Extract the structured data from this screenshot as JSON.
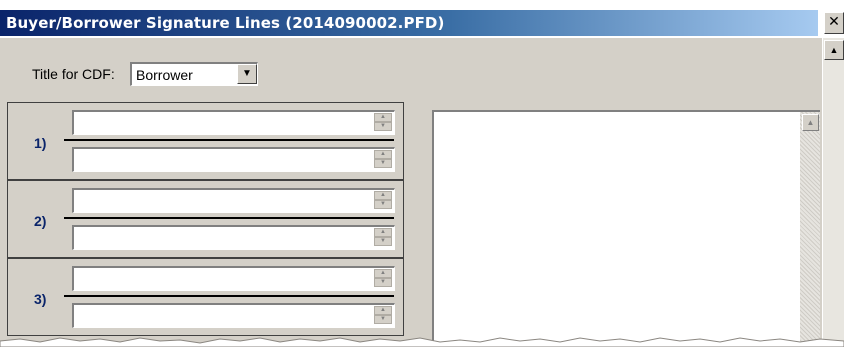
{
  "window": {
    "title": "Buyer/Borrower Signature Lines (2014090002.PFD)",
    "close_glyph": "✕"
  },
  "cdf": {
    "label": "Title for CDF:",
    "selected": "Borrower"
  },
  "signature_groups": [
    {
      "number": "1)",
      "line1": "",
      "line2": ""
    },
    {
      "number": "2)",
      "line1": "",
      "line2": ""
    },
    {
      "number": "3)",
      "line1": "",
      "line2": ""
    }
  ],
  "icons": {
    "dropdown": "chevron-down-icon",
    "spin": "spin-arrows-icon",
    "scroll_up": "scroll-up-icon"
  }
}
